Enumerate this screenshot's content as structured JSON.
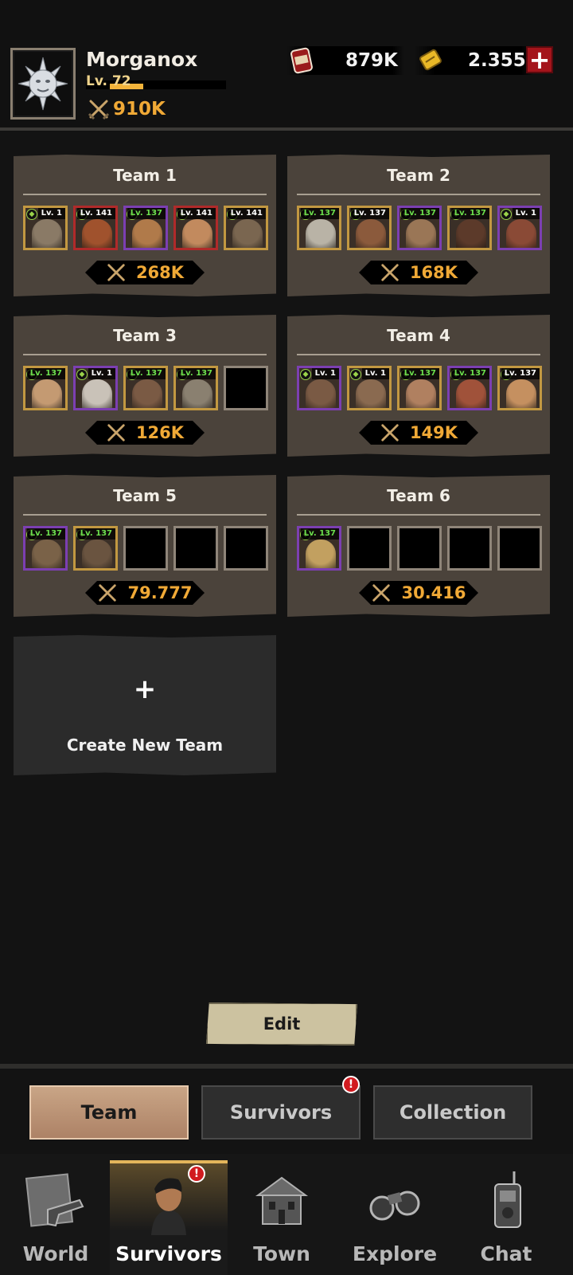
{
  "player": {
    "name": "Morganox",
    "level": "Lv. 72",
    "level_progress": 0.24,
    "power": "910K"
  },
  "resources": {
    "food": "879K",
    "tickets": "2.355"
  },
  "teams": [
    {
      "title": "Team 1",
      "power": "268K",
      "members": [
        {
          "level": "Lv. 1",
          "lv_color": "w",
          "rarity": "gold",
          "tone": "#8a7a66"
        },
        {
          "level": "Lv. 141",
          "lv_color": "w",
          "rarity": "red",
          "tone": "#a0522d"
        },
        {
          "level": "Lv. 137",
          "lv_color": "g",
          "rarity": "purple",
          "tone": "#b07a4a"
        },
        {
          "level": "Lv. 141",
          "lv_color": "w",
          "rarity": "red",
          "tone": "#c28a5e"
        },
        {
          "level": "Lv. 141",
          "lv_color": "w",
          "rarity": "gold",
          "tone": "#7a6650"
        }
      ]
    },
    {
      "title": "Team 2",
      "power": "168K",
      "members": [
        {
          "level": "Lv. 137",
          "lv_color": "g",
          "rarity": "gold",
          "tone": "#b9b3a6"
        },
        {
          "level": "Lv. 137",
          "lv_color": "w",
          "rarity": "gold",
          "tone": "#8b5a3c"
        },
        {
          "level": "Lv. 137",
          "lv_color": "g",
          "rarity": "purple",
          "tone": "#9a7656"
        },
        {
          "level": "Lv. 137",
          "lv_color": "g",
          "rarity": "gold",
          "tone": "#5c3a2a"
        },
        {
          "level": "Lv. 1",
          "lv_color": "w",
          "rarity": "purple",
          "tone": "#8a4a36"
        }
      ]
    },
    {
      "title": "Team 3",
      "power": "126K",
      "members": [
        {
          "level": "Lv. 137",
          "lv_color": "g",
          "rarity": "gold",
          "tone": "#c49a72"
        },
        {
          "level": "Lv. 1",
          "lv_color": "w",
          "rarity": "purple",
          "tone": "#c9c2b8"
        },
        {
          "level": "Lv. 137",
          "lv_color": "g",
          "rarity": "gold",
          "tone": "#7a5a44"
        },
        {
          "level": "Lv. 137",
          "lv_color": "g",
          "rarity": "gold",
          "tone": "#8a8070"
        },
        null
      ]
    },
    {
      "title": "Team 4",
      "power": "149K",
      "members": [
        {
          "level": "Lv. 1",
          "lv_color": "w",
          "rarity": "purple",
          "tone": "#7a5a44"
        },
        {
          "level": "Lv. 1",
          "lv_color": "w",
          "rarity": "gold",
          "tone": "#8a6a50"
        },
        {
          "level": "Lv. 137",
          "lv_color": "g",
          "rarity": "gold",
          "tone": "#b08060"
        },
        {
          "level": "Lv. 137",
          "lv_color": "g",
          "rarity": "purple",
          "tone": "#a0523a"
        },
        {
          "level": "Lv. 137",
          "lv_color": "w",
          "rarity": "gold",
          "tone": "#c59060"
        }
      ]
    },
    {
      "title": "Team 5",
      "power": "79.777",
      "members": [
        {
          "level": "Lv. 137",
          "lv_color": "g",
          "rarity": "purple",
          "tone": "#7a6248"
        },
        {
          "level": "Lv. 137",
          "lv_color": "g",
          "rarity": "gold",
          "tone": "#6a5440"
        },
        null,
        null,
        null
      ]
    },
    {
      "title": "Team 6",
      "power": "30.416",
      "members": [
        {
          "level": "Lv. 137",
          "lv_color": "g",
          "rarity": "purple",
          "tone": "#c2a060"
        },
        null,
        null,
        null,
        null
      ]
    }
  ],
  "create_team": {
    "plus": "+",
    "label": "Create New Team"
  },
  "edit_label": "Edit",
  "subtabs": [
    {
      "label": "Team",
      "active": true,
      "badge": ""
    },
    {
      "label": "Survivors",
      "active": false,
      "badge": "!"
    },
    {
      "label": "Collection",
      "active": false,
      "badge": ""
    }
  ],
  "nav": [
    {
      "label": "World",
      "icon": "map-revolver-icon",
      "active": false,
      "badge": ""
    },
    {
      "label": "Survivors",
      "icon": "survivor-portrait-icon",
      "active": true,
      "badge": "!"
    },
    {
      "label": "Town",
      "icon": "house-icon",
      "active": false,
      "badge": ""
    },
    {
      "label": "Explore",
      "icon": "binoculars-icon",
      "active": false,
      "badge": ""
    },
    {
      "label": "Chat",
      "icon": "walkie-talkie-icon",
      "active": false,
      "badge": ""
    }
  ],
  "colors": {
    "accent": "#f0a936",
    "card": "#4b433b",
    "badge": "#d11b20"
  }
}
